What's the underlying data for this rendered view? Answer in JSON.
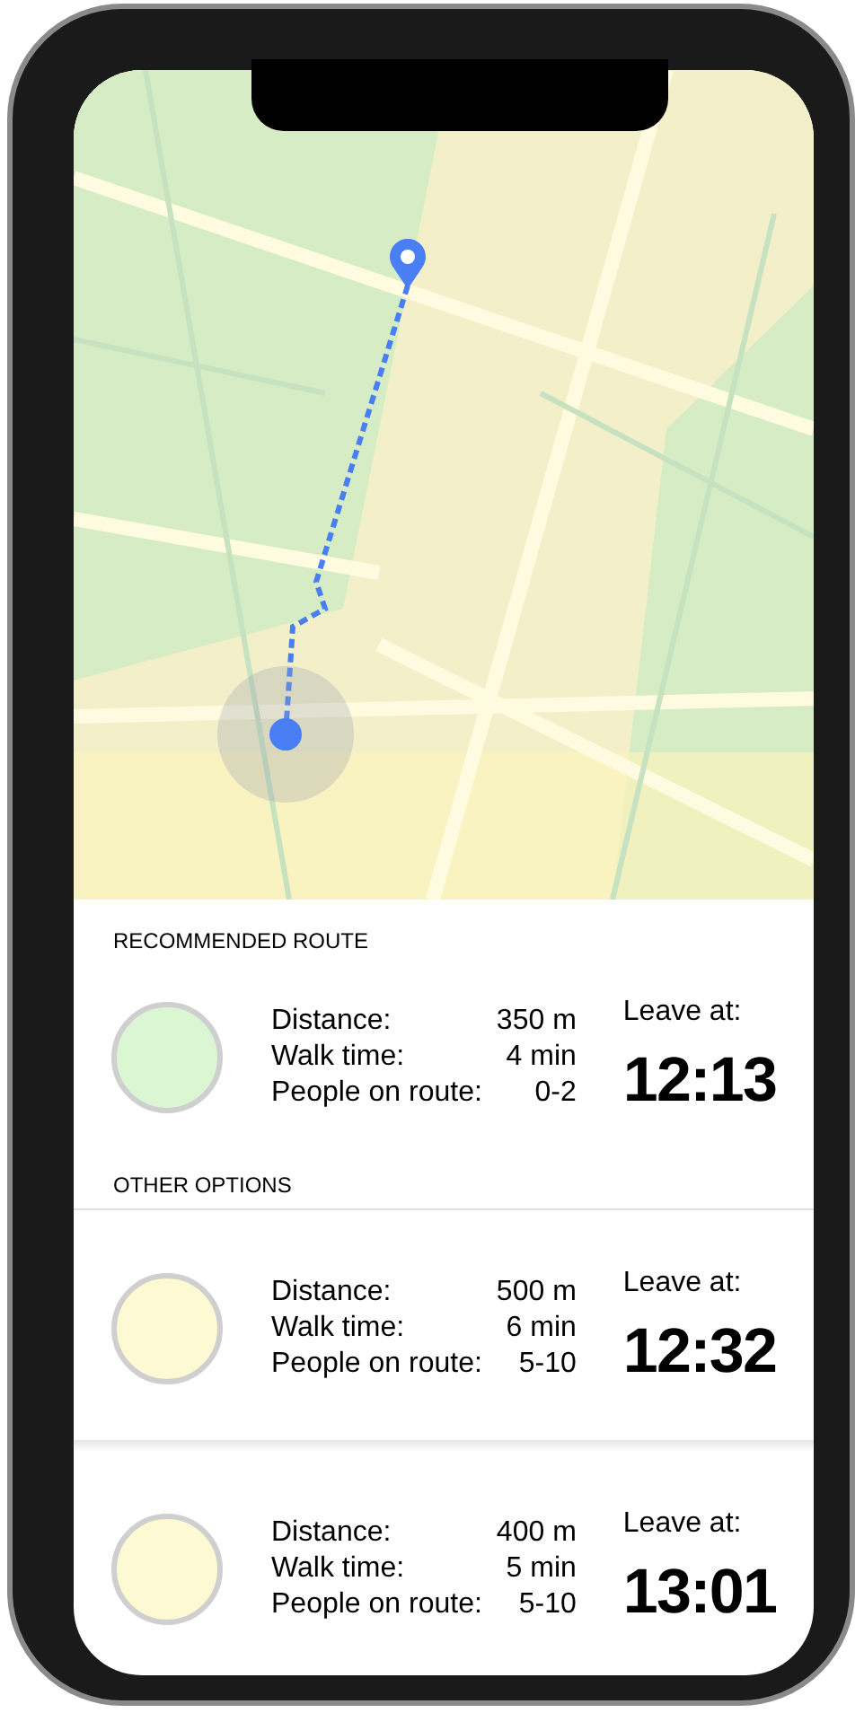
{
  "recommended": {
    "heading": "RECOMMENDED ROUTE",
    "route": {
      "color": "#dbf6d3",
      "rows": [
        {
          "label": "Distance:",
          "value": "350 m"
        },
        {
          "label": "Walk time:",
          "value": "4 min"
        },
        {
          "label": "People on route:",
          "value": "0-2"
        }
      ],
      "leave_label": "Leave at:",
      "time": "12:13"
    }
  },
  "other": {
    "heading": "OTHER OPTIONS",
    "routes": [
      {
        "color": "#fdf9d3",
        "rows": [
          {
            "label": "Distance:",
            "value": "500 m"
          },
          {
            "label": "Walk time:",
            "value": "6 min"
          },
          {
            "label": "People on route:",
            "value": "5-10"
          }
        ],
        "leave_label": "Leave at:",
        "time": "12:32"
      },
      {
        "color": "#fdf9d3",
        "rows": [
          {
            "label": "Distance:",
            "value": "400 m"
          },
          {
            "label": "Walk time:",
            "value": "5 min"
          },
          {
            "label": "People on route:",
            "value": "5-10"
          }
        ],
        "leave_label": "Leave at:",
        "time": "13:01"
      }
    ]
  }
}
